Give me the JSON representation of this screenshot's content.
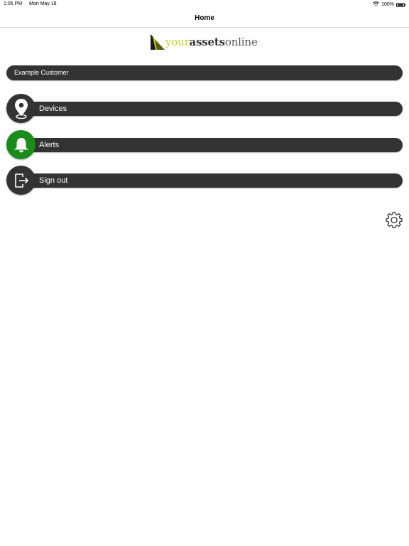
{
  "status_bar": {
    "time": "1:05 PM",
    "date": "Mon May 18",
    "battery": "100%",
    "icons": [
      "wifi-icon",
      "battery-icon"
    ]
  },
  "nav": {
    "title": "Home"
  },
  "logo": {
    "part1": "your",
    "part2": "assets",
    "part3": "online"
  },
  "customer": {
    "name": "Example Customer"
  },
  "menu": [
    {
      "label": "Devices",
      "icon": "location-pin-icon"
    },
    {
      "label": "Alerts",
      "icon": "bell-icon"
    },
    {
      "label": "Sign out",
      "icon": "sign-out-icon"
    }
  ],
  "settings": {
    "icon": "gear-icon"
  },
  "colors": {
    "bar": "#333333",
    "alerts_circle": "#1a8c1a",
    "logo_your": "#c9cc2a"
  }
}
